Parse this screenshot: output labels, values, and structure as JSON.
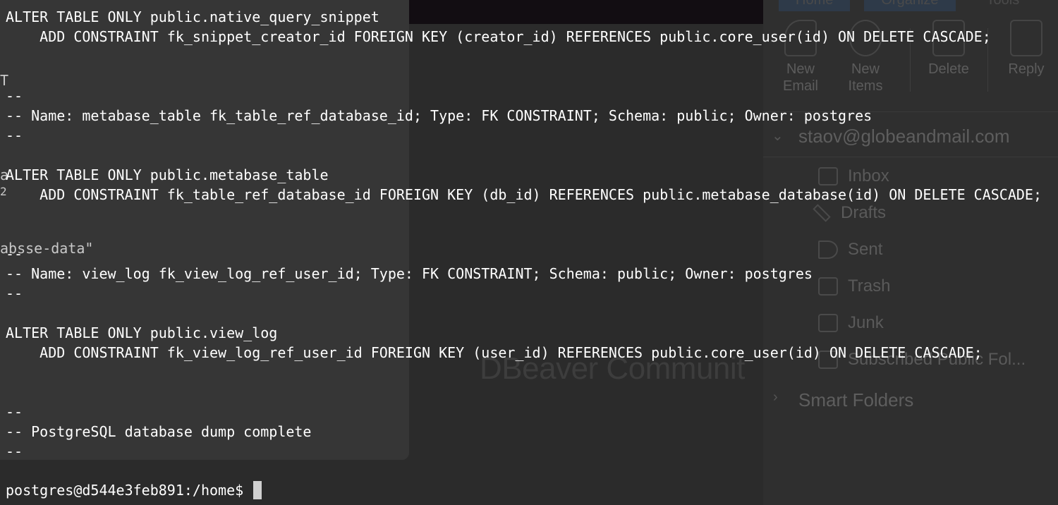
{
  "background": {
    "editor_fragments": [
      "T",
      "a",
      "2",
      "absse-data\""
    ],
    "dbeaver_text": "DBeaver Communit",
    "mail": {
      "tabs": [
        "Home",
        "Organize",
        "Tools"
      ],
      "ribbon": [
        {
          "label": "New\nEmail",
          "icon": "new-email-icon"
        },
        {
          "label": "New\nItems",
          "icon": "new-items-icon"
        },
        {
          "label": "Delete",
          "icon": "delete-icon"
        },
        {
          "label": "Reply",
          "icon": "reply-icon"
        }
      ],
      "account": "staov@globeandmail.com",
      "folders": [
        {
          "label": "Inbox",
          "icon": "inbox-icon"
        },
        {
          "label": "Drafts",
          "icon": "drafts-icon"
        },
        {
          "label": "Sent",
          "icon": "sent-icon"
        },
        {
          "label": "Trash",
          "icon": "trash-icon"
        },
        {
          "label": "Junk",
          "icon": "junk-icon"
        },
        {
          "label": "Subscribed Public Fol...",
          "icon": "subscribed-folder-icon"
        }
      ],
      "smart_folders": "Smart Folders"
    }
  },
  "terminal": {
    "lines": [
      "ALTER TABLE ONLY public.native_query_snippet",
      "    ADD CONSTRAINT fk_snippet_creator_id FOREIGN KEY (creator_id) REFERENCES public.core_user(id) ON DELETE CASCADE;",
      "",
      "",
      "--",
      "-- Name: metabase_table fk_table_ref_database_id; Type: FK CONSTRAINT; Schema: public; Owner: postgres",
      "--",
      "",
      "ALTER TABLE ONLY public.metabase_table",
      "    ADD CONSTRAINT fk_table_ref_database_id FOREIGN KEY (db_id) REFERENCES public.metabase_database(id) ON DELETE CASCADE;",
      "",
      "",
      "--",
      "-- Name: view_log fk_view_log_ref_user_id; Type: FK CONSTRAINT; Schema: public; Owner: postgres",
      "--",
      "",
      "ALTER TABLE ONLY public.view_log",
      "    ADD CONSTRAINT fk_view_log_ref_user_id FOREIGN KEY (user_id) REFERENCES public.core_user(id) ON DELETE CASCADE;",
      "",
      "",
      "--",
      "-- PostgreSQL database dump complete",
      "--"
    ],
    "prompt": "postgres@d544e3feb891:/home$ "
  }
}
